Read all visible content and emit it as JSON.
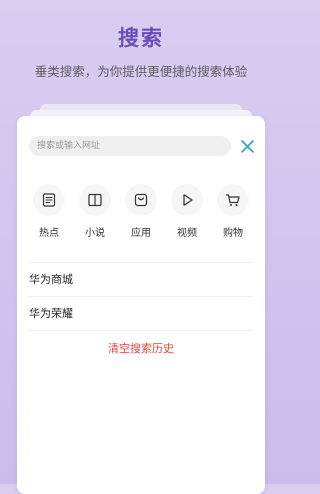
{
  "header": {
    "title": "搜索",
    "subtitle": "垂类搜索，为你提供更便捷的搜索体验"
  },
  "search": {
    "placeholder": "搜索或输入网址",
    "value": ""
  },
  "categories": [
    {
      "label": "热点",
      "icon": "news-icon"
    },
    {
      "label": "小说",
      "icon": "book-icon"
    },
    {
      "label": "应用",
      "icon": "app-store-icon"
    },
    {
      "label": "视频",
      "icon": "play-icon"
    },
    {
      "label": "购物",
      "icon": "cart-icon"
    }
  ],
  "history": {
    "items": [
      "华为商城",
      "华为荣耀"
    ],
    "clear_label": "清空搜索历史"
  },
  "colors": {
    "accent": "#6a4fb8",
    "close": "#3aa5b5",
    "clear": "#e5453a"
  }
}
